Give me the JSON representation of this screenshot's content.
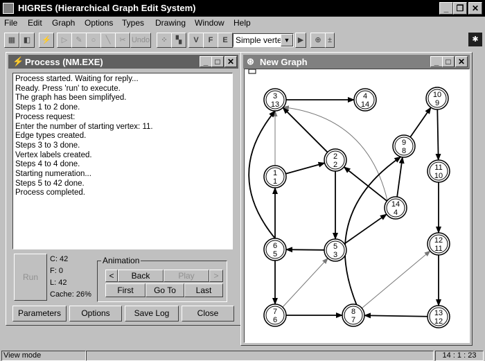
{
  "app": {
    "title": "HIGRES (Hierarchical Graph Edit System)"
  },
  "menu": [
    "File",
    "Edit",
    "Graph",
    "Options",
    "Types",
    "Drawing",
    "Window",
    "Help"
  ],
  "toolbar": {
    "undo_label": "Undo",
    "drawing_style": "Simple verte:",
    "buttons_left": [
      "save-icon",
      "open-icon",
      "run-icon",
      "forward-icon",
      "edit-icon",
      "vertex-icon",
      "edge-icon",
      "cut-icon"
    ],
    "buttons_right": [
      "grid-icon",
      "layout-icon",
      "vertex-type-icon",
      "face-type-icon",
      "edge-type-icon"
    ]
  },
  "process_window": {
    "title": "Process (NM.EXE)",
    "log": [
      "Process started. Waiting for reply...",
      "Ready. Press 'run' to execute.",
      "The graph has been simplifyed.",
      "Steps 1 to 2 done.",
      "Process request:",
      "Enter the number of starting vertex: 11.",
      "Edge types created.",
      "Steps 3 to 3 done.",
      "Vertex labels created.",
      "Steps 4 to 4 done.",
      "Starting numeration...",
      "Steps 5 to 42 done.",
      "Process completed."
    ],
    "run_label": "Run",
    "stats": {
      "c": "C: 42",
      "f": "F: 0",
      "l": "L: 42",
      "cache": "Cache: 26%"
    },
    "animation": {
      "group_label": "Animation",
      "prev": "<",
      "back": "Back",
      "play": "Play",
      "next": ">",
      "first": "First",
      "goto": "Go To",
      "last": "Last"
    },
    "buttons": {
      "parameters": "Parameters",
      "options": "Options",
      "save_log": "Save Log",
      "close": "Close"
    }
  },
  "graph_window": {
    "title": "New Graph",
    "nodes": [
      {
        "id": "n3",
        "top": "3",
        "bottom": "13"
      },
      {
        "id": "n4",
        "top": "4",
        "bottom": "14"
      },
      {
        "id": "n10",
        "top": "10",
        "bottom": "9"
      },
      {
        "id": "n9",
        "top": "9",
        "bottom": "8"
      },
      {
        "id": "n2",
        "top": "2",
        "bottom": "2"
      },
      {
        "id": "n1",
        "top": "1",
        "bottom": "1"
      },
      {
        "id": "n11",
        "top": "11",
        "bottom": "10"
      },
      {
        "id": "n14",
        "top": "14",
        "bottom": "4"
      },
      {
        "id": "n12",
        "top": "12",
        "bottom": "11"
      },
      {
        "id": "n6",
        "top": "6",
        "bottom": "5"
      },
      {
        "id": "n5",
        "top": "5",
        "bottom": "3"
      },
      {
        "id": "n7",
        "top": "7",
        "bottom": "6"
      },
      {
        "id": "n8",
        "top": "8",
        "bottom": "7"
      },
      {
        "id": "n13",
        "top": "13",
        "bottom": "12"
      }
    ]
  },
  "status": {
    "mode": "View mode",
    "time": "14 : 1 : 23"
  }
}
